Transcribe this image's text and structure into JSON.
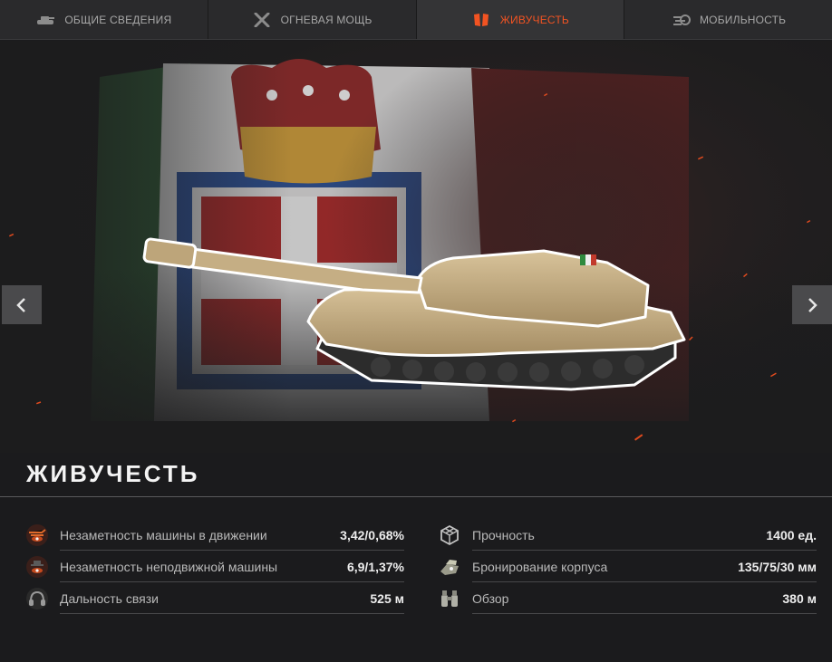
{
  "tabs": [
    {
      "label": "ОБЩИЕ СВЕДЕНИЯ",
      "icon": "tank-icon",
      "active": false
    },
    {
      "label": "ОГНЕВАЯ МОЩЬ",
      "icon": "crossed-guns-icon",
      "active": false
    },
    {
      "label": "ЖИВУЧЕСТЬ",
      "icon": "armor-plates-icon",
      "active": true
    },
    {
      "label": "МОБИЛЬНОСТЬ",
      "icon": "speed-icon",
      "active": false
    }
  ],
  "colors": {
    "accent": "#f25322",
    "background": "#1b1b1d",
    "tab_bg": "#2a2a2c"
  },
  "section": {
    "title": "ЖИВУЧЕСТЬ"
  },
  "stats_left": [
    {
      "label": "Незаметность машины в движении",
      "value": "3,42/0,68%",
      "icon": "moving-camo-icon"
    },
    {
      "label": "Незаметность неподвижной машины",
      "value": "6,9/1,37%",
      "icon": "stationary-camo-icon"
    },
    {
      "label": "Дальность связи",
      "value": "525 м",
      "icon": "radio-headset-icon"
    }
  ],
  "stats_right": [
    {
      "label": "Прочность",
      "value": "1400 ед.",
      "icon": "hit-points-icon"
    },
    {
      "label": "Бронирование корпуса",
      "value": "135/75/30 мм",
      "icon": "hull-armor-icon"
    },
    {
      "label": "Обзор",
      "value": "380 м",
      "icon": "binoculars-icon"
    }
  ]
}
